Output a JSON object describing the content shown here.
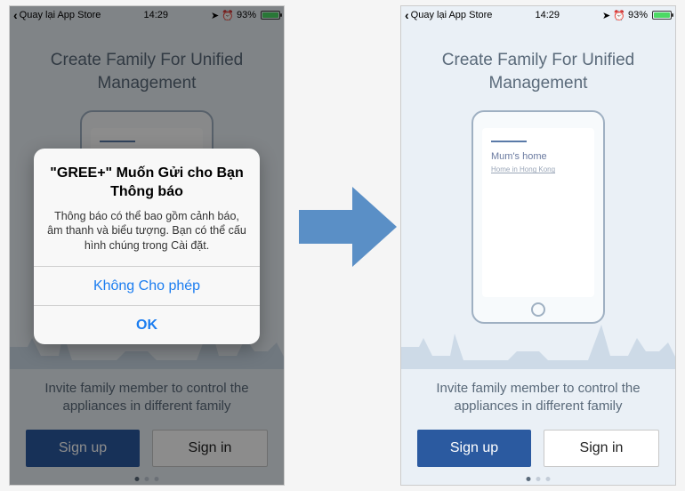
{
  "status": {
    "back_label": "Quay lại App Store",
    "time": "14:29",
    "battery_pct": "93%"
  },
  "onboarding": {
    "headline_l1": "Create Family For Unified",
    "headline_l2": "Management",
    "illus_label_1": "Mum's home",
    "illus_label_2": "Home in Hong Kong",
    "subline_l1": "Invite family member to control the",
    "subline_l2": "appliances in different family",
    "signup": "Sign up",
    "signin": "Sign in"
  },
  "alert": {
    "title": "\"GREE+\" Muốn Gửi cho Bạn Thông báo",
    "message": "Thông báo có thể bao gồm cảnh báo, âm thanh và biểu tượng. Bạn có thể cấu hình chúng trong Cài đặt.",
    "deny": "Không Cho phép",
    "allow": "OK"
  }
}
